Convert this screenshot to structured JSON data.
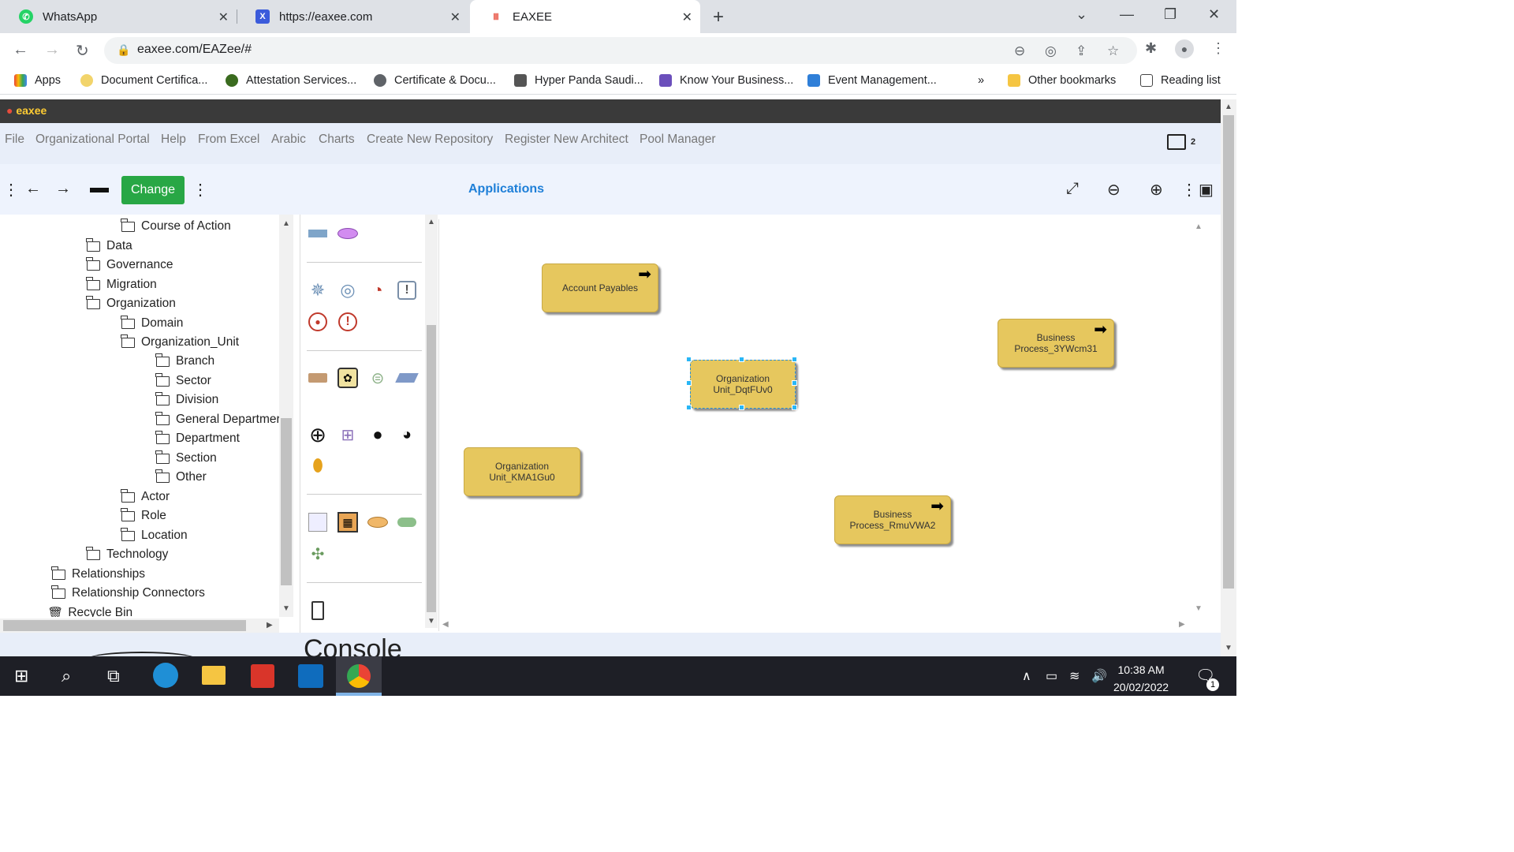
{
  "browser": {
    "tabs": [
      {
        "title": "WhatsApp",
        "icon": "whatsapp-icon",
        "color": "#25d366"
      },
      {
        "title": "https://eaxee.com",
        "icon": "eaxee-icon",
        "color": "#3b5bdb"
      },
      {
        "title": "EAXEE",
        "icon": "eaxee-icon",
        "color": "#e74c3c"
      }
    ],
    "url": "eaxee.com/EAZee/#",
    "bookmarks": [
      {
        "label": "Apps"
      },
      {
        "label": "Document Certifica..."
      },
      {
        "label": "Attestation Services..."
      },
      {
        "label": "Certificate & Docu..."
      },
      {
        "label": "Hyper Panda Saudi..."
      },
      {
        "label": "Know Your Business..."
      },
      {
        "label": "Event Management..."
      },
      {
        "label": "»"
      },
      {
        "label": "Other bookmarks"
      },
      {
        "label": "Reading list"
      }
    ]
  },
  "app": {
    "logo": "eaxee",
    "menu": [
      "File",
      "Organizational Portal",
      "Help",
      "From Excel",
      "Arabic",
      "Charts",
      "Create New Repository",
      "Register New Architect",
      "Pool Manager"
    ],
    "tab_count": "2",
    "change_label": "Change",
    "title": "Applications",
    "tree": [
      {
        "label": "Course of Action"
      },
      {
        "label": "Data"
      },
      {
        "label": "Governance"
      },
      {
        "label": "Migration"
      },
      {
        "label": "Organization"
      },
      {
        "label": "Domain"
      },
      {
        "label": "Organization_Unit"
      },
      {
        "label": "Branch"
      },
      {
        "label": "Sector"
      },
      {
        "label": "Division"
      },
      {
        "label": "General Departmer"
      },
      {
        "label": "Department"
      },
      {
        "label": "Section"
      },
      {
        "label": "Other"
      },
      {
        "label": "Actor"
      },
      {
        "label": "Role"
      },
      {
        "label": "Location"
      },
      {
        "label": "Technology"
      },
      {
        "label": "Relationships"
      },
      {
        "label": "Relationship Connectors"
      },
      {
        "label": "Recycle Bin"
      }
    ],
    "nodes": [
      {
        "label": "Account Payables",
        "arrow": "➡"
      },
      {
        "label": "Business Process_3YWcm31",
        "arrow": "➡"
      },
      {
        "label": "Organization Unit_DqtFUv0",
        "arrow": ""
      },
      {
        "label": "Organization Unit_KMA1Gu0",
        "arrow": ""
      },
      {
        "label": "Business Process_RmuVWA2",
        "arrow": "➡"
      }
    ],
    "console_label": "Console"
  },
  "taskbar": {
    "time": "10:38 AM",
    "date": "20/02/2022",
    "notifications": "1"
  }
}
